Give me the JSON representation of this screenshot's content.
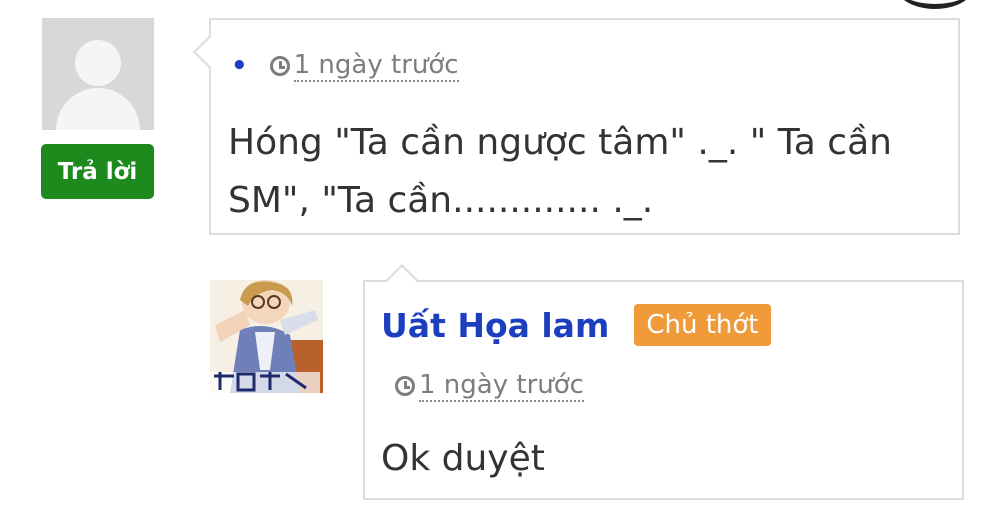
{
  "comment": {
    "reply_button": "Trả lời",
    "author_dot": "•",
    "time": "1 ngày trước",
    "content": "Hóng \"Ta cần ngược tâm\" ._. \" Ta cần SM\", \"Ta cần............. ._."
  },
  "reply": {
    "author": "Uất Họa lam",
    "badge": "Chủ thớt",
    "time": "1 ngày trước",
    "content": "Ok duyệt"
  },
  "colors": {
    "reply_button": "#1e8a1e",
    "author_link": "#1b3fbf",
    "owner_badge": "#f09a3a",
    "meta_gray": "#7d7d7d"
  }
}
